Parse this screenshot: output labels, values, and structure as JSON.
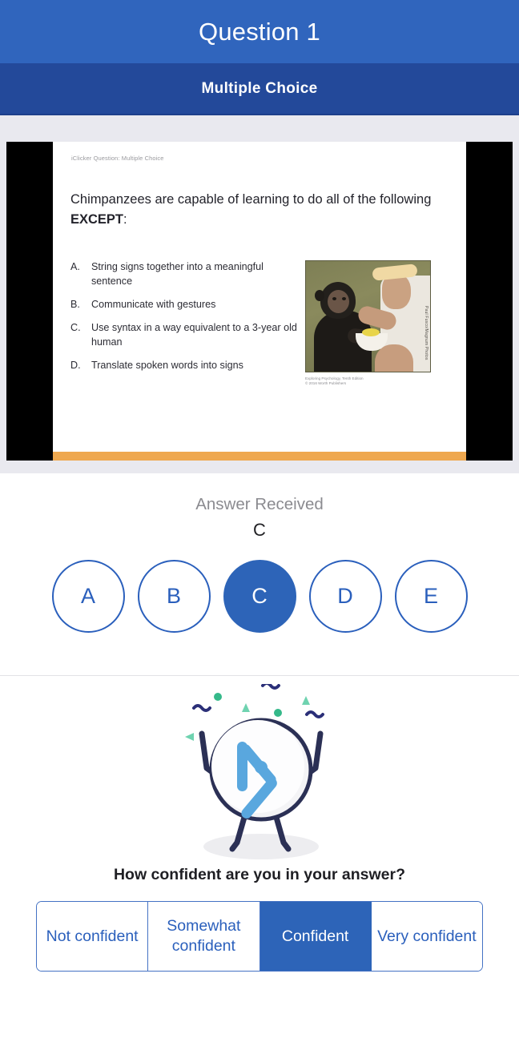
{
  "header": {
    "title": "Question 1",
    "subtitle": "Multiple Choice"
  },
  "slide": {
    "kicker": "iClicker Question: Multiple Choice",
    "question_part1": "Chimpanzees are capable of learning to do all of the following ",
    "question_emphasis": "EXCEPT",
    "question_part2": ":",
    "choices": [
      {
        "letter": "A.",
        "text": "String signs together into a meaningful sentence"
      },
      {
        "letter": "B.",
        "text": "Communicate with gestures"
      },
      {
        "letter": "C.",
        "text": "Use syntax in a way equivalent to a 3-year old human"
      },
      {
        "letter": "D.",
        "text": "Translate spoken words into signs"
      }
    ],
    "figure_credit": "Paul Fusco/Magnum Photos",
    "figure_caption_line1": "Exploring Psychology, Tenth Edition",
    "figure_caption_line2": "© 2016 Worth Publishers",
    "accent_color": "#EFA84F"
  },
  "answer": {
    "label": "Answer Received",
    "value": "C",
    "options": [
      {
        "label": "A",
        "selected": false
      },
      {
        "label": "B",
        "selected": false
      },
      {
        "label": "C",
        "selected": true
      },
      {
        "label": "D",
        "selected": false
      },
      {
        "label": "E",
        "selected": false
      }
    ]
  },
  "mascot": {
    "icon_name": "iclicker-logo-mascot",
    "logo_color": "#59A7DE",
    "body_color": "#2B3055"
  },
  "confidence": {
    "question": "How confident are you in your answer?",
    "options": [
      {
        "label": "Not confident",
        "selected": false
      },
      {
        "label": "Somewhat confident",
        "selected": false
      },
      {
        "label": "Confident",
        "selected": true
      },
      {
        "label": "Very confident",
        "selected": false
      }
    ]
  },
  "colors": {
    "header_top": "#3065BD",
    "header_sub": "#23499A",
    "accent_blue": "#2D64B8",
    "outline_blue": "#2A5FBC",
    "page_bg": "#E9E9EF"
  }
}
